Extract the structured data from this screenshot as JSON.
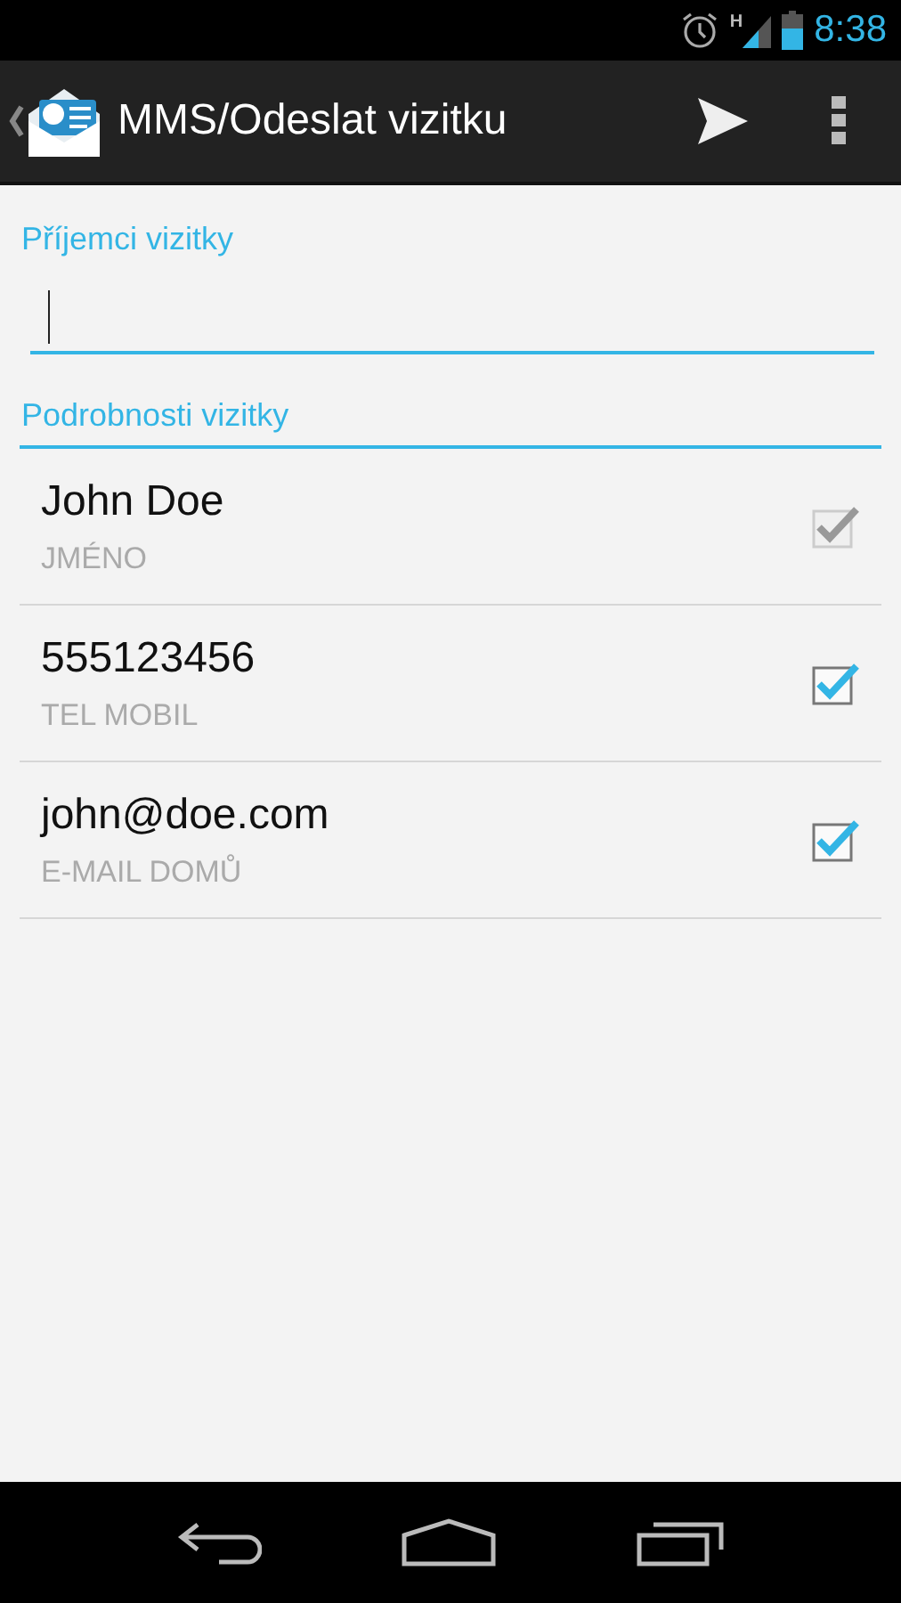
{
  "status_bar": {
    "time": "8:38",
    "network": "H"
  },
  "action_bar": {
    "title": "MMS/Odeslat vizitku"
  },
  "recipients": {
    "label": "Příjemci vizitky"
  },
  "details": {
    "label": "Podrobnosti vizitky",
    "items": [
      {
        "value": "John Doe",
        "type": "JMÉNO",
        "checked": true,
        "disabled": true
      },
      {
        "value": "555123456",
        "type": "TEL MOBIL",
        "checked": true,
        "disabled": false
      },
      {
        "value": "john@doe.com",
        "type": "E-MAIL DOMŮ",
        "checked": true,
        "disabled": false
      }
    ]
  }
}
